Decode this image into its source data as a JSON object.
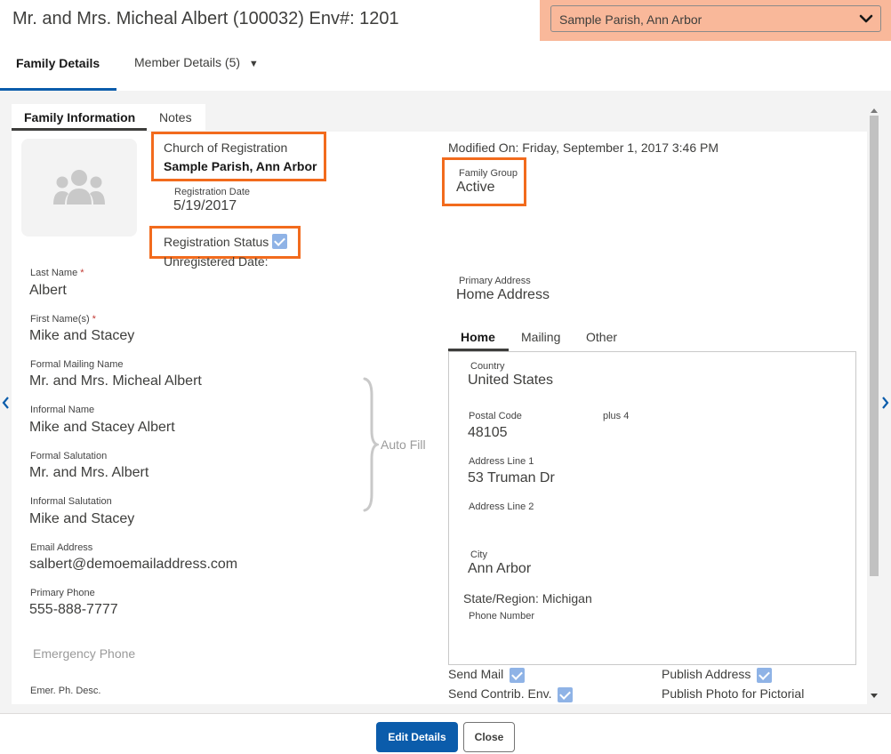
{
  "header": {
    "title": "Mr. and Mrs. Micheal Albert (100032) Env#: 1201",
    "parish_select": "Sample Parish, Ann Arbor"
  },
  "top_tabs": {
    "family": "Family Details",
    "member": "Member Details (5)",
    "member_caret": "▼"
  },
  "sub_tabs": {
    "family_information": "Family Information",
    "notes": "Notes"
  },
  "church": {
    "label": "Church of Registration",
    "value": "Sample Parish, Ann Arbor"
  },
  "registration_date": {
    "label": "Registration Date",
    "value": "5/19/2017"
  },
  "registration_status": {
    "label": "Registration Status",
    "checked": true
  },
  "unregistered_date": {
    "label": "Unregistered Date:"
  },
  "modified_on": "Modified On: Friday, September 1, 2017 3:46 PM",
  "family_group": {
    "label": "Family Group",
    "value": "Active"
  },
  "primary_address": {
    "label": "Primary Address",
    "value": "Home Address"
  },
  "fields": {
    "last_name": {
      "label": "Last Name",
      "required": "*",
      "value": "Albert"
    },
    "first_names": {
      "label": "First Name(s)",
      "required": "*",
      "value": "Mike and Stacey"
    },
    "formal_mailing_name": {
      "label": "Formal Mailing Name",
      "value": "Mr. and Mrs. Micheal Albert"
    },
    "informal_name": {
      "label": "Informal Name",
      "value": "Mike and Stacey Albert"
    },
    "formal_salutation": {
      "label": "Formal Salutation",
      "value": "Mr. and Mrs. Albert"
    },
    "informal_salutation": {
      "label": "Informal Salutation",
      "value": "Mike and Stacey"
    },
    "email": {
      "label": "Email Address",
      "value": "salbert@demoemailaddress.com"
    },
    "primary_phone": {
      "label": "Primary Phone",
      "value": "555-888-7777"
    },
    "emergency_phone": {
      "label": "Emergency Phone"
    },
    "emer_ph_desc": {
      "label": "Emer. Ph. Desc."
    }
  },
  "auto_fill": "Auto Fill",
  "address_tabs": {
    "home": "Home",
    "mailing": "Mailing",
    "other": "Other"
  },
  "address": {
    "country": {
      "label": "Country",
      "value": "United States"
    },
    "postal_code": {
      "label": "Postal Code",
      "value": "48105"
    },
    "plus4": {
      "label": "plus 4"
    },
    "line1": {
      "label": "Address Line 1",
      "value": "53 Truman Dr"
    },
    "line2": {
      "label": "Address Line 2"
    },
    "city": {
      "label": "City",
      "value": "Ann Arbor"
    },
    "state": "State/Region: Michigan",
    "phone": {
      "label": "Phone Number"
    }
  },
  "options": {
    "send_mail": "Send Mail",
    "send_contrib_env": "Send Contrib. Env.",
    "publish_address": "Publish Address",
    "publish_photo": "Publish Photo for Pictorial"
  },
  "footer": {
    "edit": "Edit Details",
    "close": "Close"
  },
  "colors": {
    "accent": "#0b5cab",
    "highlight": "#f26b1d",
    "parish_bg": "#f9b89a"
  }
}
